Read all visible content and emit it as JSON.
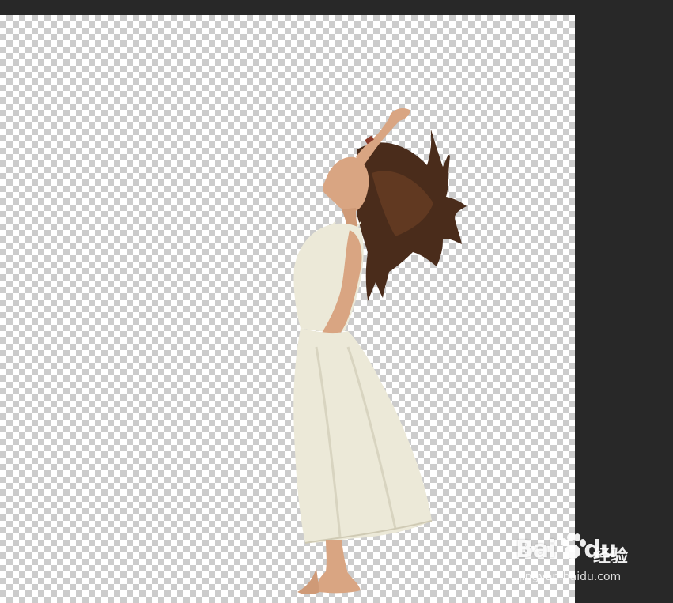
{
  "watermark": {
    "logo_text": "Bai",
    "logo_text_2": "du",
    "brand_text": "经验",
    "url_text": "jingyan.baidu.com"
  },
  "canvas": {
    "background": "transparent-checkerboard",
    "subject": "woman in white dress with flowing hair, cut out"
  },
  "colors": {
    "workspace": "#282828",
    "checker_light": "#ffffff",
    "checker_dark": "#cccccc",
    "dress": "#ece9d8",
    "skin": "#d9a582",
    "hair": "#4a2c1b"
  }
}
